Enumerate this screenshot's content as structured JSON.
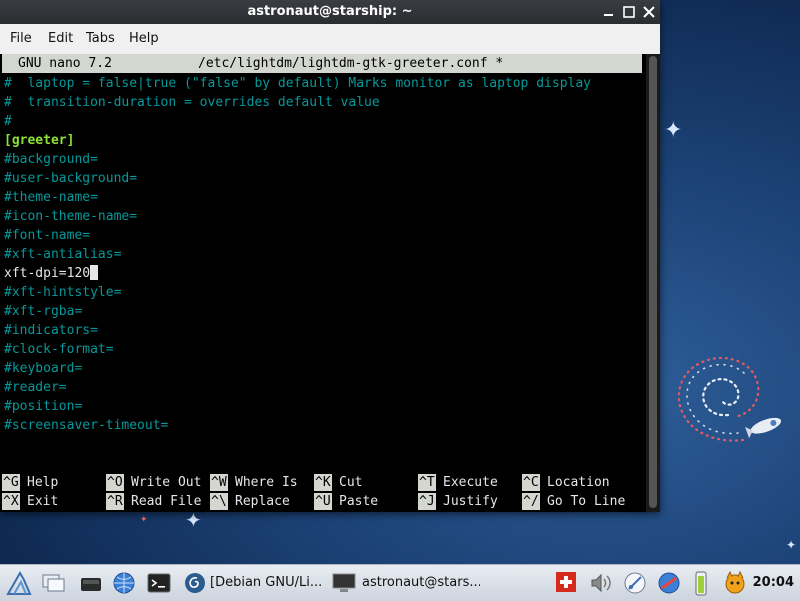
{
  "window": {
    "title": "astronaut@starship: ~"
  },
  "menu": [
    "File",
    "Edit",
    "Tabs",
    "Help"
  ],
  "nano": {
    "version": "GNU nano 7.2",
    "filename": "/etc/lightdm/lightdm-gtk-greeter.conf *"
  },
  "editor_lines": [
    "#  laptop = false|true (\"false\" by default) Marks monitor as laptop display",
    "#  transition-duration = overrides default value",
    "#",
    "[greeter]",
    "#background=",
    "#user-background=",
    "#theme-name=",
    "#icon-theme-name=",
    "#font-name=",
    "#xft-antialias=",
    "xft-dpi=120",
    "#xft-hintstyle=",
    "#xft-rgba=",
    "#indicators=",
    "#clock-format=",
    "#keyboard=",
    "#reader=",
    "#position=",
    "#screensaver-timeout="
  ],
  "shortcuts": [
    {
      "key": "^G",
      "label": "Help"
    },
    {
      "key": "^O",
      "label": "Write Out"
    },
    {
      "key": "^W",
      "label": "Where Is"
    },
    {
      "key": "^K",
      "label": "Cut"
    },
    {
      "key": "^T",
      "label": "Execute"
    },
    {
      "key": "^C",
      "label": "Location"
    },
    {
      "key": "^X",
      "label": "Exit"
    },
    {
      "key": "^R",
      "label": "Read File"
    },
    {
      "key": "^\\",
      "label": "Replace"
    },
    {
      "key": "^U",
      "label": "Paste"
    },
    {
      "key": "^J",
      "label": "Justify"
    },
    {
      "key": "^/",
      "label": "Go To Line"
    }
  ],
  "taskbar": {
    "tasks": [
      "[Debian GNU/Li...",
      "astronaut@stars..."
    ],
    "clock": "20:04"
  },
  "colors": {
    "comment": "#06989a",
    "section": "#8ae234",
    "header_bg": "#d3d7cf",
    "desktop": "#1c4276"
  }
}
